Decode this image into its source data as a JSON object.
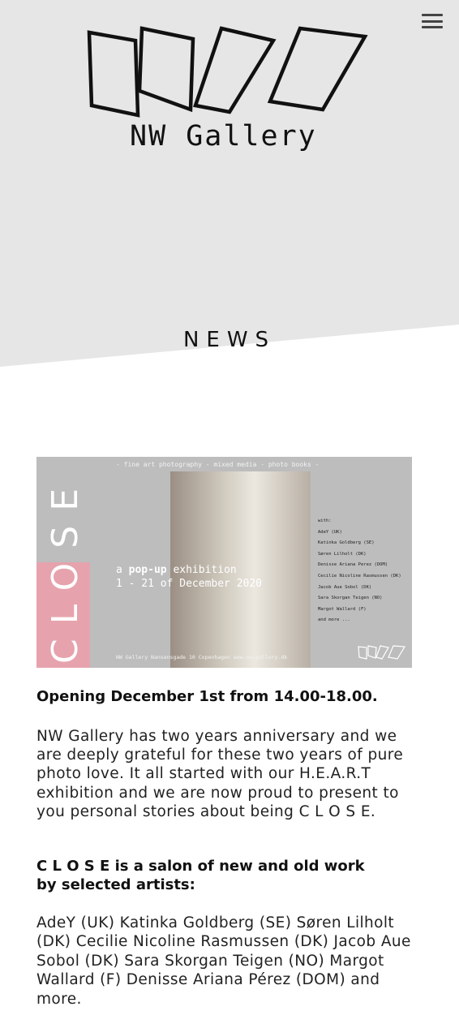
{
  "header": {
    "brand_name": "NW Gallery",
    "menu_icon": "hamburger-menu-icon"
  },
  "page": {
    "section_title": "NEWS"
  },
  "poster": {
    "vertical_title": "CLOSE",
    "top_line": "-   fine art photography   -   mixed media   -   photo books   -",
    "popup_line1_prefix": "a",
    "popup_line1_bold": "pop-up",
    "popup_line1_suffix": "exhibition",
    "popup_line2": "1 - 21 of December 2020",
    "artists_heading": "with:",
    "artists": [
      "AdeY (UK)",
      "Katinka Goldberg (SE)",
      "Søren Lilholt (DK)",
      "Denisse Ariana Perez (DOM)",
      "Cecilie Nicoline Rasmussen (DK)",
      "Jacob Aue Sobol (DK)",
      "Sara Skorgan Teigen (NO)",
      "Margot Wallard (F)",
      "and more ..."
    ],
    "bottom_line": "NW Gallery     Nansensgade 10     Copenhagen     www.nw-gallery.dk"
  },
  "article": {
    "opening": "Opening December 1st from 14.00-18.00.",
    "intro": "NW Gallery has two years anniversary and we are deeply grateful for these two years of pure photo love. It all started with our H.E.A.R.T exhibition and we are now proud to present to you personal stories about being C L O S E.",
    "close_heading_line1": "C L O S E is a salon of new and old work",
    "close_heading_line2": "by selected artists:",
    "artist_list": "AdeY (UK) Katinka Goldberg (SE) Søren Lilholt (DK) Cecilie Nicoline Rasmussen (DK) Jacob Aue Sobol (DK) Sara Skorgan Teigen (NO) Margot Wallard (F) Denisse Ariana Pérez (DOM) and more."
  }
}
